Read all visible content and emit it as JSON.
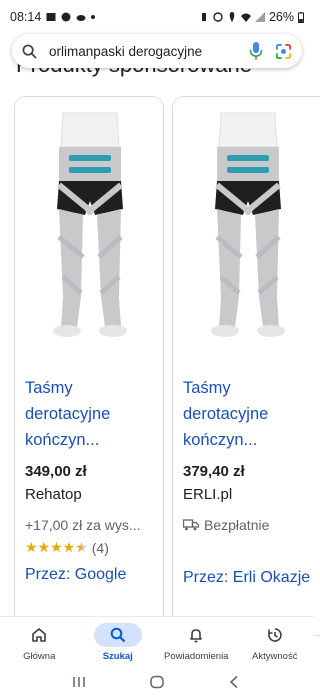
{
  "status_bar": {
    "time": "08:14",
    "battery": "26%"
  },
  "search": {
    "query": "orlimanpaski derogacyjne"
  },
  "section": {
    "title": "Produkty sponsorowane"
  },
  "products": [
    {
      "title_line1": "Taśmy",
      "title_line2": "derotacyjne",
      "title_line3": "kończyn...",
      "price": "349,00 zł",
      "seller": "Rehatop",
      "shipping": "+17,00 zł za wys...",
      "rating_count": "(4)",
      "rating_value": 4.5,
      "via": "Przez: Google"
    },
    {
      "title_line1": "Taśmy",
      "title_line2": "derotacyjne",
      "title_line3": "kończyn...",
      "price": "379,40 zł",
      "seller": "ERLI.pl",
      "shipping": "Bezpłatnie",
      "via": "Przez: Erli Okazje"
    }
  ],
  "bottom_nav": [
    {
      "label": "Główna",
      "icon": "home-icon"
    },
    {
      "label": "Szukaj",
      "icon": "search-icon",
      "active": true
    },
    {
      "label": "Powiadomienia",
      "icon": "bell-icon"
    },
    {
      "label": "Aktywność",
      "icon": "activity-icon"
    }
  ],
  "colors": {
    "link": "#1a4fb0",
    "active_nav_bg": "#d3e3fd",
    "star": "#e8a800",
    "brace_teal": "#2a9db0"
  }
}
